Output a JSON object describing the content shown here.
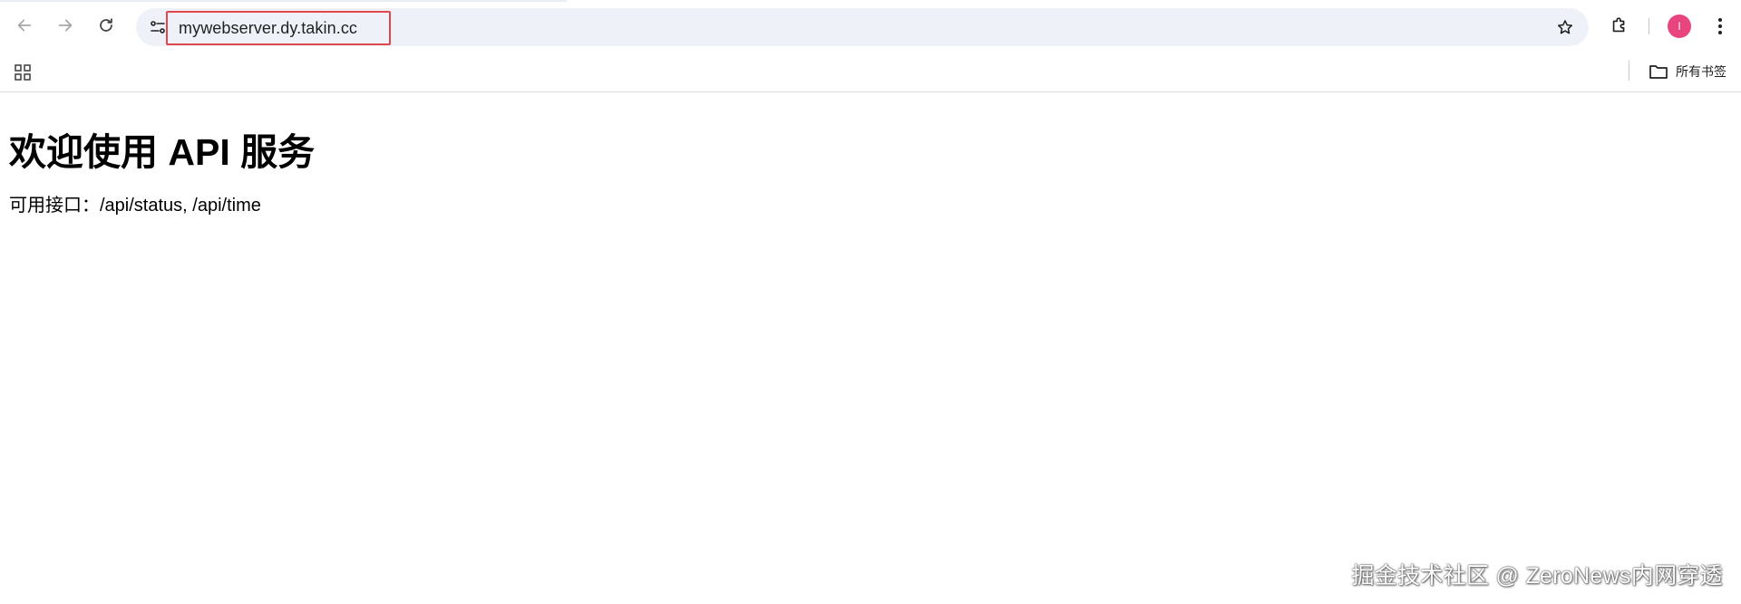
{
  "browser": {
    "url": "mywebserver.dy.takin.cc",
    "avatar_initial": "I",
    "bookmarks_folder_label": "所有书签"
  },
  "page": {
    "title": "欢迎使用 API 服务",
    "description": "可用接口：/api/status, /api/time"
  },
  "watermark": "掘金技术社区 @ ZeroNews内网穿透",
  "icons": {
    "back": "arrow-left-icon",
    "forward": "arrow-right-icon",
    "reload": "reload-icon",
    "site_info": "tune-icon",
    "bookmark": "star-icon",
    "extensions": "puzzle-icon",
    "menu": "kebab-menu-icon",
    "apps": "apps-grid-icon",
    "folder": "folder-icon"
  },
  "colors": {
    "highlight_border": "#e0474c",
    "avatar_bg": "#e8457f",
    "omnibox_bg": "#eef2f8"
  }
}
